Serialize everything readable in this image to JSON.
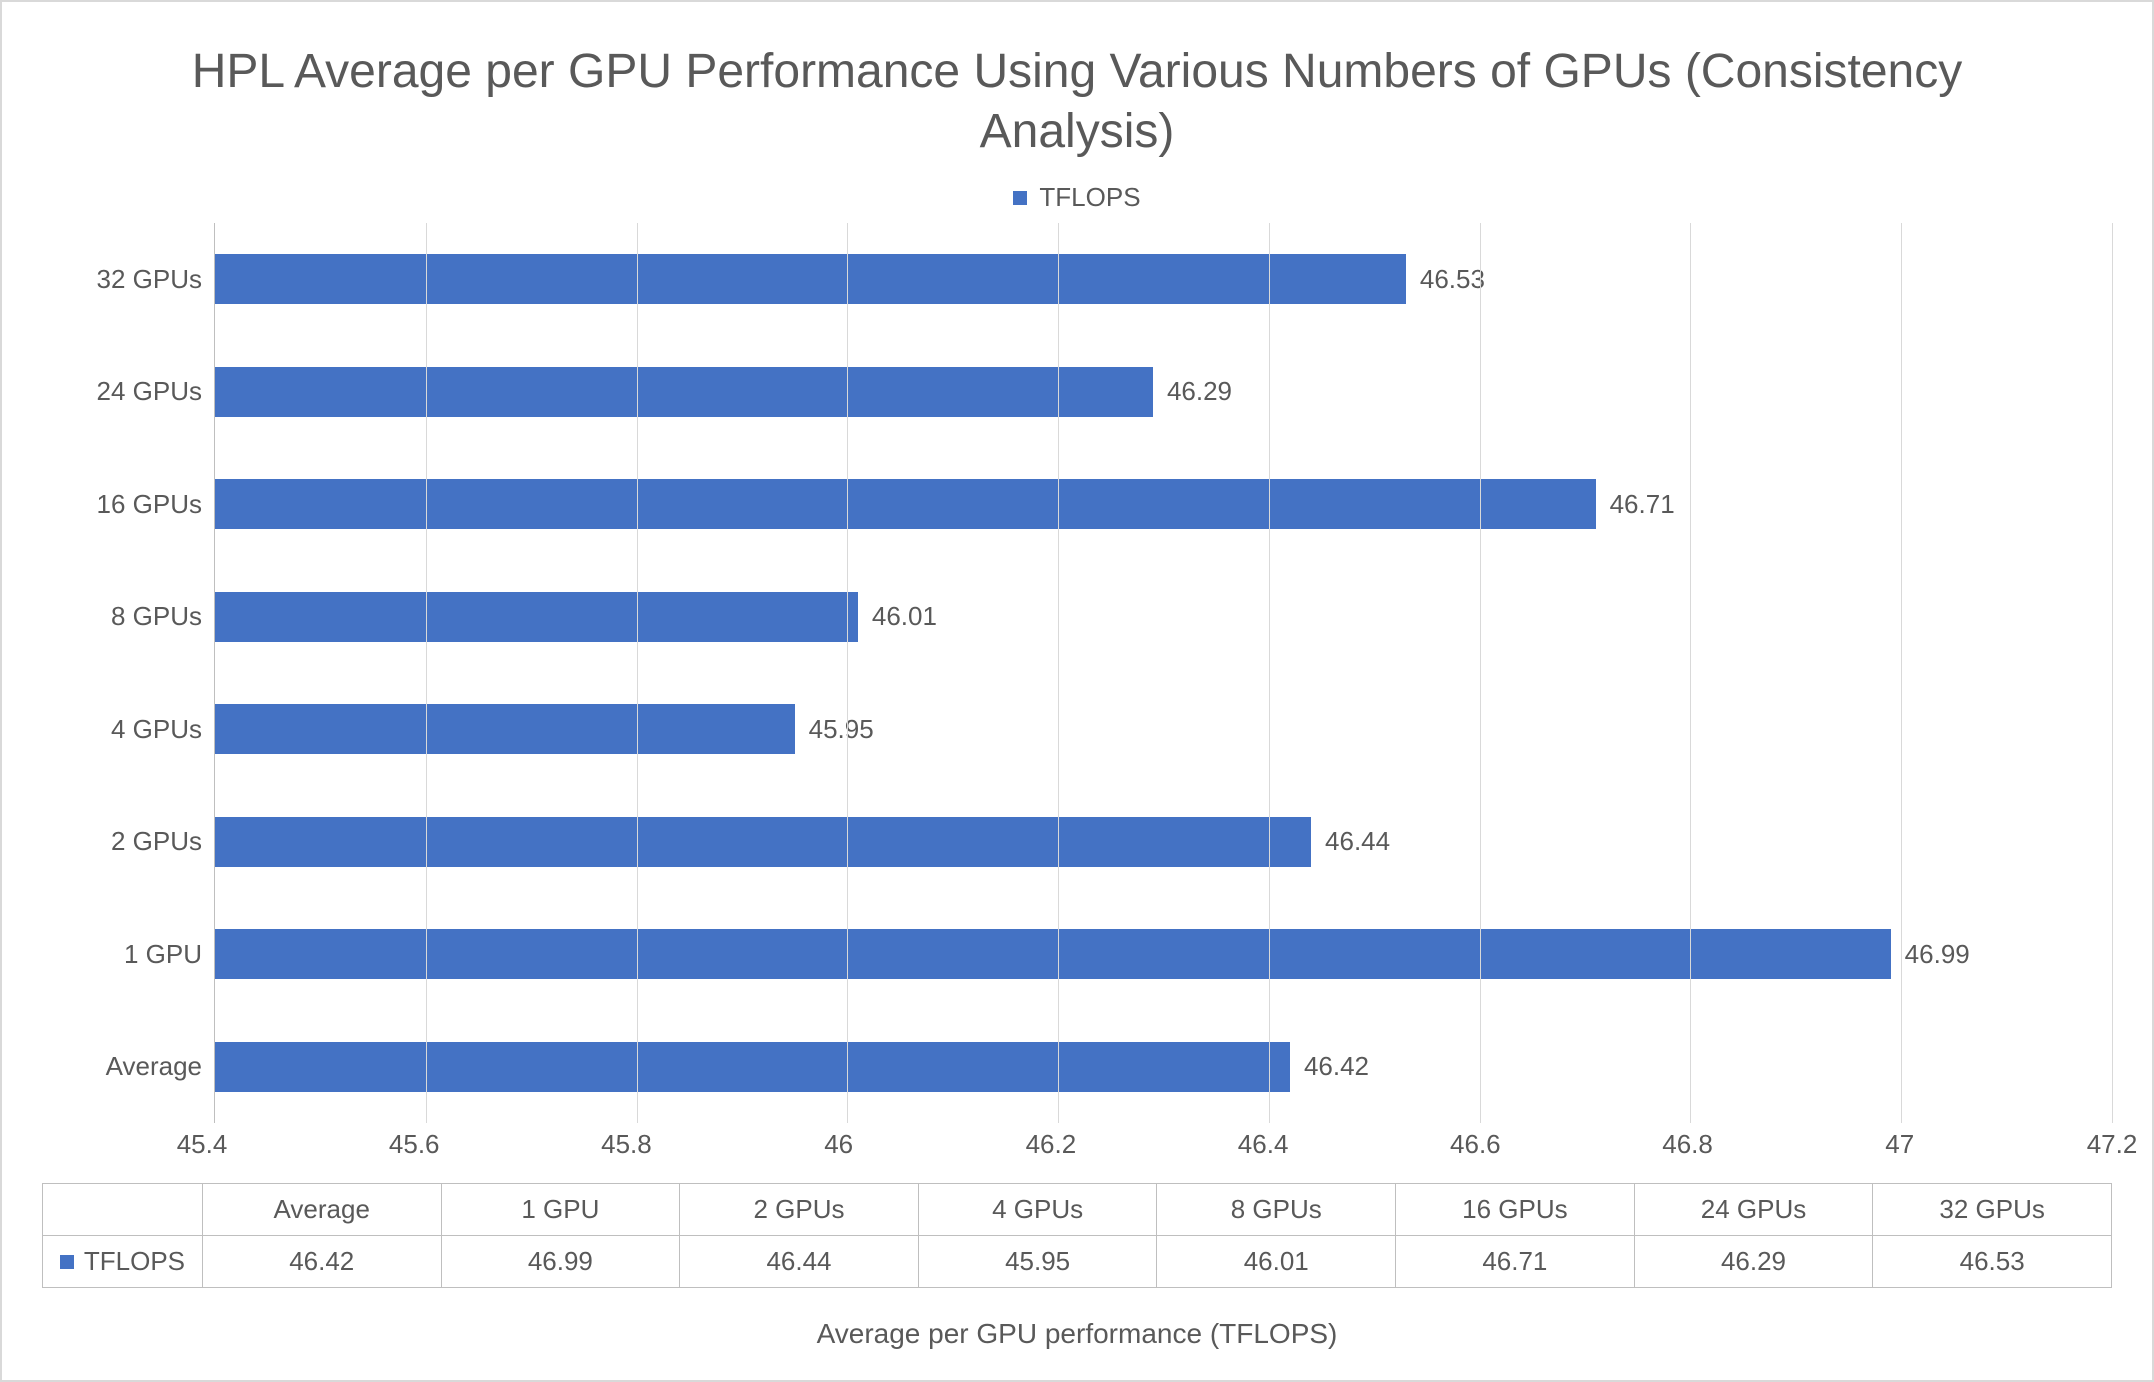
{
  "chart_data": {
    "type": "bar",
    "orientation": "horizontal",
    "title": "HPL Average per GPU Performance Using Various Numbers of GPUs (Consistency Analysis)",
    "xlabel": "Average per GPU performance (TFLOPS)",
    "ylabel": "",
    "series_name": "TFLOPS",
    "categories": [
      "Average",
      "1 GPU",
      "2 GPUs",
      "4 GPUs",
      "8 GPUs",
      "16 GPUs",
      "24 GPUs",
      "32 GPUs"
    ],
    "values": [
      46.42,
      46.99,
      46.44,
      45.95,
      46.01,
      46.71,
      46.29,
      46.53
    ],
    "value_labels": [
      "46.42",
      "46.99",
      "46.44",
      "45.95",
      "46.01",
      "46.71",
      "46.29",
      "46.53"
    ],
    "xlim": [
      45.4,
      47.2
    ],
    "xticks": [
      45.4,
      45.6,
      45.8,
      46,
      46.2,
      46.4,
      46.6,
      46.8,
      47,
      47.2
    ],
    "xtick_labels": [
      "45.4",
      "45.6",
      "45.8",
      "46",
      "46.2",
      "46.4",
      "46.6",
      "46.8",
      "47",
      "47.2"
    ],
    "bar_color": "#4472C4",
    "legend_position": "top"
  },
  "table": {
    "header_blank": "",
    "row_label": "TFLOPS"
  }
}
